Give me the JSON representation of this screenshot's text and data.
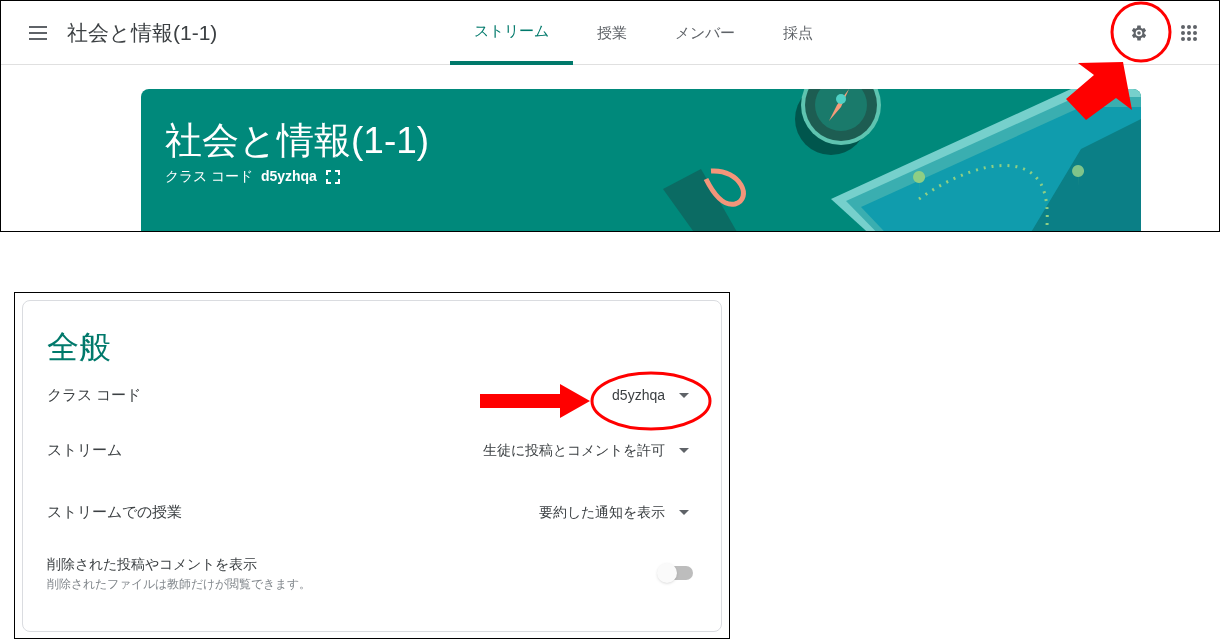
{
  "classroom_screenshot": {
    "header": {
      "title": "社会と情報(1-1)",
      "tabs": [
        {
          "label": "ストリーム",
          "selected": true
        },
        {
          "label": "授業",
          "selected": false
        },
        {
          "label": "メンバー",
          "selected": false
        },
        {
          "label": "採点",
          "selected": false
        }
      ]
    },
    "banner": {
      "title": "社会と情報(1-1)",
      "class_code_label": "クラス コード",
      "class_code": "d5yzhqa"
    }
  },
  "settings_screenshot": {
    "section_title": "全般",
    "rows": [
      {
        "kind": "dropdown",
        "label": "クラス コード",
        "value": "d5yzhqa"
      },
      {
        "kind": "dropdown",
        "label": "ストリーム",
        "value": "生徒に投稿とコメントを許可"
      },
      {
        "kind": "dropdown",
        "label": "ストリームでの授業",
        "value": "要約した通知を表示"
      },
      {
        "kind": "toggle",
        "label": "削除された投稿やコメントを表示",
        "description": "削除されたファイルは教師だけが閲覧できます。",
        "on": false
      }
    ]
  }
}
